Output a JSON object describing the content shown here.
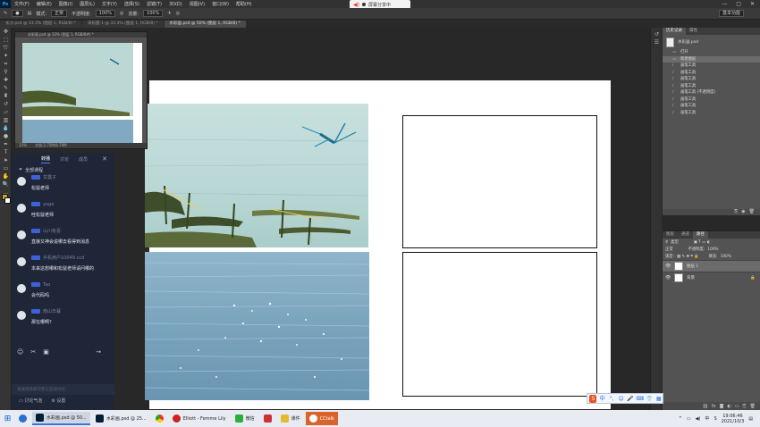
{
  "menubar": {
    "items": [
      "文件(F)",
      "编辑(E)",
      "图像(I)",
      "图层(L)",
      "文字(Y)",
      "选择(S)",
      "滤镜(T)",
      "3D(D)",
      "视图(V)",
      "窗口(W)",
      "帮助(H)"
    ]
  },
  "share": {
    "label": "屏幕分享中"
  },
  "options": {
    "mode_label": "模式:",
    "mode_value": "正常",
    "opacity_label": "不透明度:",
    "opacity_value": "100%",
    "flow_label": "流量:",
    "flow_value": "100%",
    "workspace": "基本功能"
  },
  "tabs": [
    {
      "label": "长沙.psd @ 33.3% (图层 1, RGB/8) *",
      "active": false
    },
    {
      "label": "未标题-1 @ 33.3% (图层 1, RGB/8) *",
      "active": false
    },
    {
      "label": "水彩画.psd @ 50% (图层 1, RGB/8) *",
      "active": true
    }
  ],
  "navigator": {
    "title": "水彩画.psd @ 33% (图层 1, RGB/8#) *",
    "zoom": "33%",
    "doc_info": "文档:2.75M/8.79M"
  },
  "chat": {
    "tabs": [
      "转播",
      "讨论",
      "成员"
    ],
    "filter": "全部课程",
    "messages": [
      {
        "name": "甘露子",
        "text": "松鼠老师"
      },
      {
        "name": "yoga",
        "text": "哇松鼠老师"
      },
      {
        "name": "山川有喜",
        "text": "直接又神会说哪去看得到消息"
      },
      {
        "name": "手机用户10049 ccd",
        "text": "本来这想哪和松鼠老师请问哪的"
      },
      {
        "name": "Tao",
        "text": "会代码吗"
      },
      {
        "name": "南山日暮",
        "text": "那在哪啊?"
      }
    ],
    "input_placeholder": "发送消息即可参与互动讨论",
    "discussion": "讨论气泡",
    "settings": "设置"
  },
  "history": {
    "tabs": [
      "历史记录",
      "属性"
    ],
    "snapshot": "水彩画.psd",
    "items": [
      "打开",
      "新建图层",
      "画笔工具",
      "画笔工具",
      "画笔工具",
      "画笔工具",
      "画笔工具 (不透明度)",
      "画笔工具",
      "画笔工具",
      "画笔工具"
    ],
    "selected_index": 1
  },
  "layers": {
    "tabs": [
      "图层",
      "通道",
      "路径"
    ],
    "kind": "类型",
    "blend": "正常",
    "opacity_label": "不透明度:",
    "opacity": "100%",
    "lock_label": "锁定:",
    "fill_label": "填充:",
    "fill": "100%",
    "items": [
      {
        "name": "图层 1",
        "selected": true
      },
      {
        "name": "背景",
        "selected": false
      }
    ]
  },
  "taskbar": {
    "items": [
      {
        "label": "水彩画.psd @ 50...",
        "state": "active"
      },
      {
        "label": "水彩画.psd @ 25...",
        "state": "normal"
      },
      {
        "label": "",
        "state": "normal"
      },
      {
        "label": "Elliott - Femme Lily",
        "state": "normal"
      },
      {
        "label": "微信",
        "state": "normal"
      },
      {
        "label": "",
        "state": "normal"
      },
      {
        "label": "课件",
        "state": "normal"
      },
      {
        "label": "CCtalk",
        "state": "highlight"
      }
    ],
    "time": "19:06:46",
    "date": "2021/10/3"
  },
  "colors": {
    "chat_bg": "#1f2638",
    "ps_bg": "#282828",
    "panel": "#535353",
    "accent": "#3d62d8",
    "cctalk": "#d9642a"
  }
}
